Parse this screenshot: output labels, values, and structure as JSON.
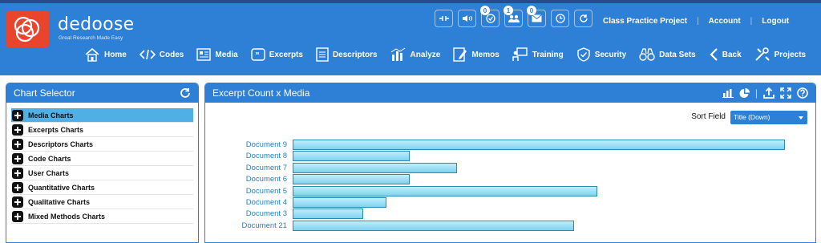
{
  "app": {
    "brand": "dedoose",
    "tagline": "Great Research Made Easy",
    "accent": "#2e7fd6"
  },
  "toolbar_icons": [
    {
      "icon": "keyboard-shortcuts-icon",
      "badge": ""
    },
    {
      "icon": "audio-icon",
      "badge": ""
    },
    {
      "icon": "check-circle-icon",
      "badge": "0"
    },
    {
      "icon": "users-icon",
      "badge": "1"
    },
    {
      "icon": "mail-icon",
      "badge": "0"
    },
    {
      "icon": "clock-icon",
      "badge": ""
    },
    {
      "icon": "refresh-icon",
      "badge": ""
    }
  ],
  "toplinks": {
    "project": "Class Practice Project",
    "account": "Account",
    "logout": "Logout"
  },
  "nav": [
    {
      "label": "Home",
      "icon": "home-icon"
    },
    {
      "label": "Codes",
      "icon": "code-icon"
    },
    {
      "label": "Media",
      "icon": "media-icon"
    },
    {
      "label": "Excerpts",
      "icon": "quote-icon"
    },
    {
      "label": "Descriptors",
      "icon": "document-icon"
    },
    {
      "label": "Analyze",
      "icon": "chart-icon",
      "active": true
    },
    {
      "label": "Memos",
      "icon": "memo-icon"
    },
    {
      "label": "Training",
      "icon": "training-icon"
    },
    {
      "label": "Security",
      "icon": "shield-icon"
    },
    {
      "label": "Data Sets",
      "icon": "binoculars-icon"
    },
    {
      "label": "Back",
      "icon": "chevron-left-icon"
    },
    {
      "label": "Projects",
      "icon": "tools-icon"
    }
  ],
  "chart_selector": {
    "title": "Chart Selector",
    "items": [
      {
        "label": "Media Charts",
        "selected": true
      },
      {
        "label": "Excerpts Charts",
        "selected": false
      },
      {
        "label": "Descriptors Charts",
        "selected": false
      },
      {
        "label": "Code Charts",
        "selected": false
      },
      {
        "label": "User Charts",
        "selected": false
      },
      {
        "label": "Quantitative Charts",
        "selected": false
      },
      {
        "label": "Qualitative Charts",
        "selected": false
      },
      {
        "label": "Mixed Methods Charts",
        "selected": false
      }
    ]
  },
  "chart_panel": {
    "title": "Excerpt Count x Media",
    "sort_label": "Sort Field",
    "sort_value": "Title (Down)"
  },
  "chart_data": {
    "type": "bar",
    "orientation": "horizontal",
    "categories": [
      "Document 9",
      "Document 8",
      "Document 7",
      "Document 6",
      "Document 5",
      "Document 4",
      "Document 3",
      "Document 21"
    ],
    "values": [
      21,
      5,
      7,
      5,
      13,
      4,
      3,
      12
    ],
    "bar_color": "#7fd2ee"
  }
}
